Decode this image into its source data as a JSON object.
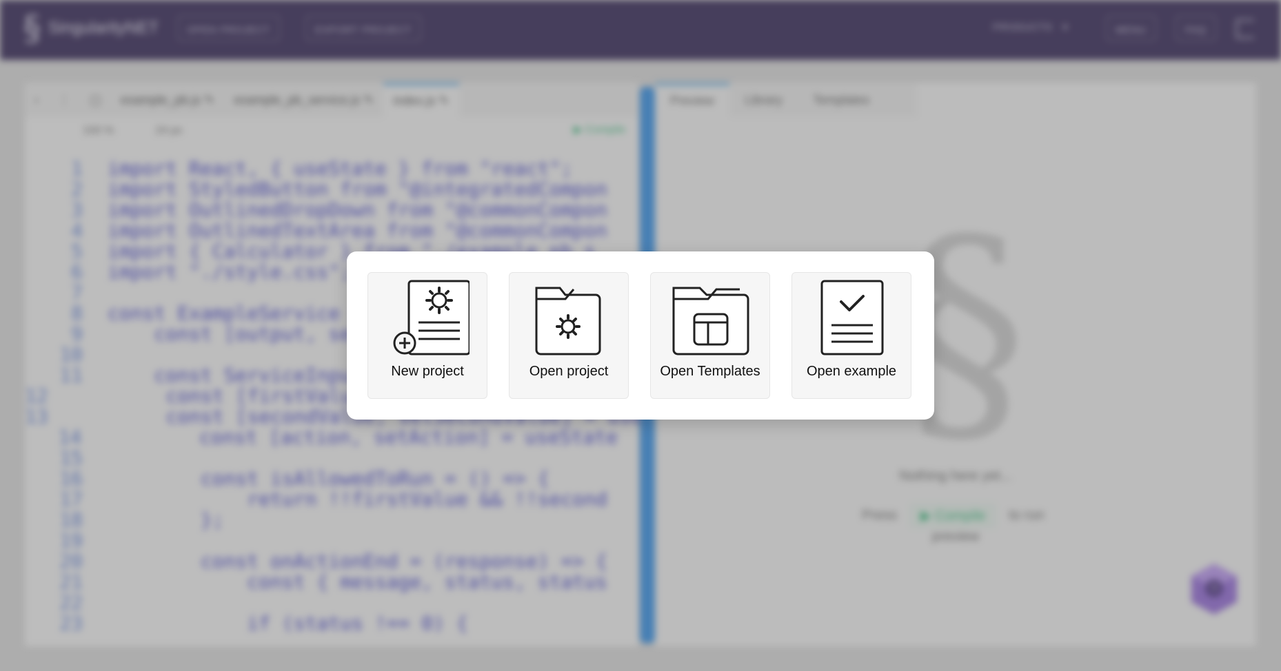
{
  "header": {
    "logo_text": "SingularityNET",
    "open_project": "OPEN PROJECT",
    "export_project": "EXPORT PROJECT",
    "products": "PRODUCTS",
    "btn_menu": "MENU",
    "btn_faq": "FAQ"
  },
  "editor": {
    "tabs": [
      "example_pb.js",
      "example_pb_service.js",
      "index.js"
    ],
    "zoom": "100 %",
    "font_size": "24 px",
    "compile": "Compile",
    "code_lines": [
      "import React, { useState } from \"react\";",
      "import StyledButton from \"@integratedCompon",
      "import OutlinedDropDown from \"@commonCompon",
      "import OutlinedTextArea from \"@commonCompon",
      "import { Calculator } from \"./example_pb_s",
      "import \"./style.css\";",
      "",
      "const ExampleService = ({",
      "    const [output, setOutput]",
      "",
      "    const ServiceInput = () => {",
      "        const [firstValue, setFirstValue] = useState",
      "        const [secondValue, setSecondValue] = useState",
      "        const [action, setAction] = useState",
      "",
      "        const isAllowedToRun = () => {",
      "            return !!firstValue && !!second",
      "        };",
      "",
      "        const onActionEnd = (response) => {",
      "            const { message, status, status",
      "",
      "            if (status !== 0) {"
    ]
  },
  "preview": {
    "tabs": [
      "Preview",
      "Library",
      "Templates"
    ],
    "nothing_here": "Nothing here yet...",
    "press": "Press",
    "compile": "Compile",
    "to_run": "to run",
    "preview_word": "preview"
  },
  "dialog": {
    "options": [
      {
        "label": "New project",
        "icon": "new-project-icon"
      },
      {
        "label": "Open project",
        "icon": "open-project-icon"
      },
      {
        "label": "Open Templates",
        "icon": "open-templates-icon"
      },
      {
        "label": "Open example",
        "icon": "open-example-icon"
      }
    ]
  },
  "colors": {
    "header_bg": "#1e0f45",
    "accent_blue": "#1f86e6",
    "compile_green": "#1fb36b",
    "code_keyword": "#2b2bc7"
  }
}
